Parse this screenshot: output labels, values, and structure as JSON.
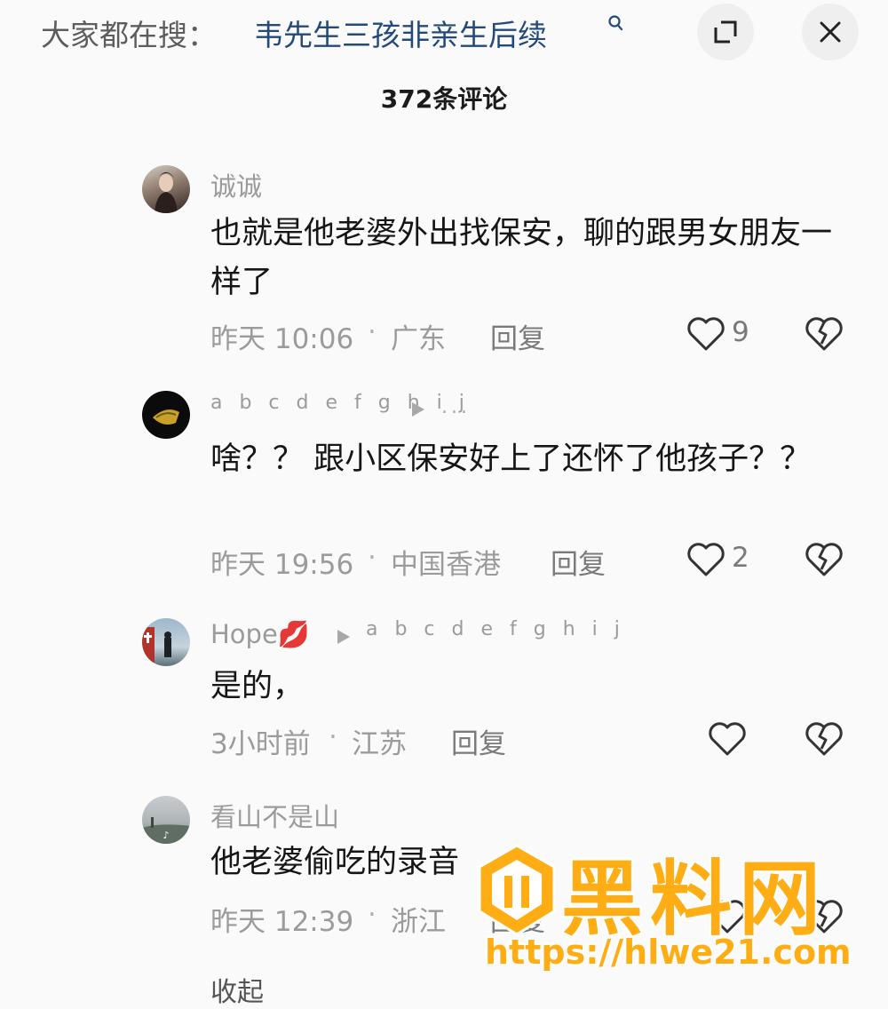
{
  "header": {
    "search_prefix": "大家都在搜：",
    "search_term": "韦先生三孩非亲生后续",
    "expand_icon": "expand-icon",
    "close_icon": "close-icon"
  },
  "comment_count": "372条评论",
  "comments": [
    {
      "username": "诚诚",
      "text": "也就是他老婆外出找保安，聊的跟男女朋友一样了",
      "time": "昨天 10:06",
      "location": "广东",
      "reply_label": "回复",
      "likes": "9"
    },
    {
      "username": "a b c d e f g h i j",
      "reply_to": "...",
      "text": "啥？？ 跟小区保安好上了还怀了他孩子？？",
      "time": "昨天 19:56",
      "location": "中国香港",
      "reply_label": "回复",
      "likes": "2"
    },
    {
      "username": "Hope💋",
      "reply_to": "a b c d e f g h i j",
      "text": "是的，",
      "time": "3小时前",
      "location": "江苏",
      "reply_label": "回复",
      "likes": ""
    },
    {
      "username": "看山不是山",
      "text": "他老婆偷吃的录音",
      "time": "昨天 12:39",
      "location": "浙江",
      "reply_label": "回复",
      "likes": ""
    }
  ],
  "collapse_label": "收起",
  "watermark": {
    "title": "黑料网",
    "url": "https://hlwe21.com"
  },
  "colors": {
    "search_term": "#234a7a",
    "watermark": "#ffad14"
  }
}
